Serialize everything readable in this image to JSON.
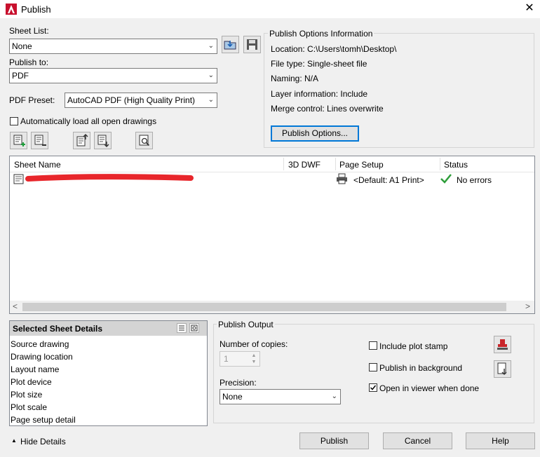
{
  "window": {
    "title": "Publish",
    "close_glyph": "✕"
  },
  "sheet_list": {
    "label": "Sheet List:",
    "value": "None"
  },
  "publish_to": {
    "label": "Publish to:",
    "value": "PDF"
  },
  "pdf_preset": {
    "label": "PDF Preset:",
    "value": "AutoCAD PDF (High Quality Print)"
  },
  "auto_load": {
    "label": "Automatically load all open drawings",
    "checked": false
  },
  "options_info": {
    "title": "Publish Options Information",
    "location": "Location:  C:\\Users\\tomh\\Desktop\\",
    "file_type": "File type:  Single-sheet file",
    "naming": "Naming:  N/A",
    "layer_info": "Layer information:  Include",
    "merge_control": "Merge control:  Lines overwrite",
    "button": "Publish Options..."
  },
  "sheet_table": {
    "columns": [
      "Sheet Name",
      "3D DWF",
      "Page Setup",
      "Status"
    ],
    "rows": [
      {
        "sheet_name": "",
        "dwf3d": "",
        "page_setup": "<Default: A1 Print>",
        "status": "No errors"
      }
    ],
    "scroll_left": "<",
    "scroll_right": ">"
  },
  "selected_details": {
    "title": "Selected Sheet Details",
    "items": [
      "Source drawing",
      "Drawing location",
      "Layout name",
      "Plot device",
      "Plot size",
      "Plot scale",
      "Page setup detail"
    ]
  },
  "publish_output": {
    "title": "Publish Output",
    "copies_label": "Number of copies:",
    "copies_value": "1",
    "precision_label": "Precision:",
    "precision_value": "None",
    "include_plot_stamp": {
      "label": "Include plot stamp",
      "checked": false
    },
    "publish_background": {
      "label": "Publish in background",
      "checked": false
    },
    "open_viewer": {
      "label": "Open in viewer when done",
      "checked": true
    }
  },
  "footer": {
    "hide_details": "Hide Details",
    "publish": "Publish",
    "cancel": "Cancel",
    "help": "Help"
  },
  "colors": {
    "redaction": "#e8262b",
    "status_check": "#2e9e3a",
    "app_icon": "#c8102e"
  }
}
